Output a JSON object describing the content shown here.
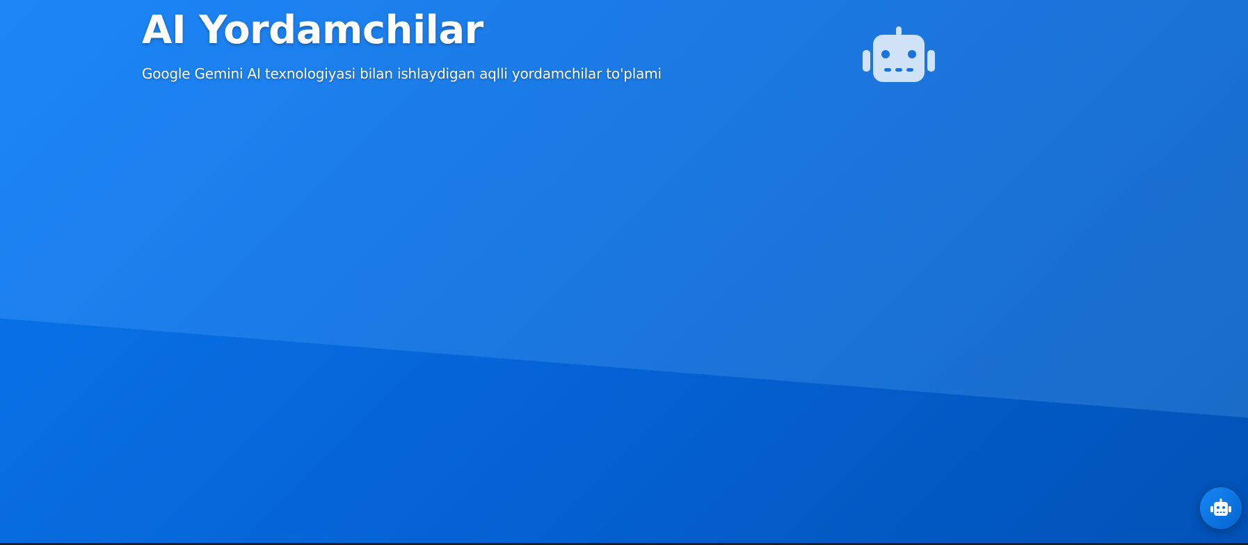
{
  "hero": {
    "title": "AI Yordamchilar",
    "subtitle": "Google Gemini AI texnologiyasi bilan ishlaydigan aqlli yordamchilar to'plami",
    "icon": "robot-icon"
  },
  "chat_button": {
    "icon": "robot-icon"
  },
  "colors": {
    "hero_gradient_start": "#1c86f7",
    "hero_gradient_end": "#0152b6",
    "icon_tint": "#cfe2f8",
    "fab": "#0a77ec",
    "text": "#ffffff"
  }
}
